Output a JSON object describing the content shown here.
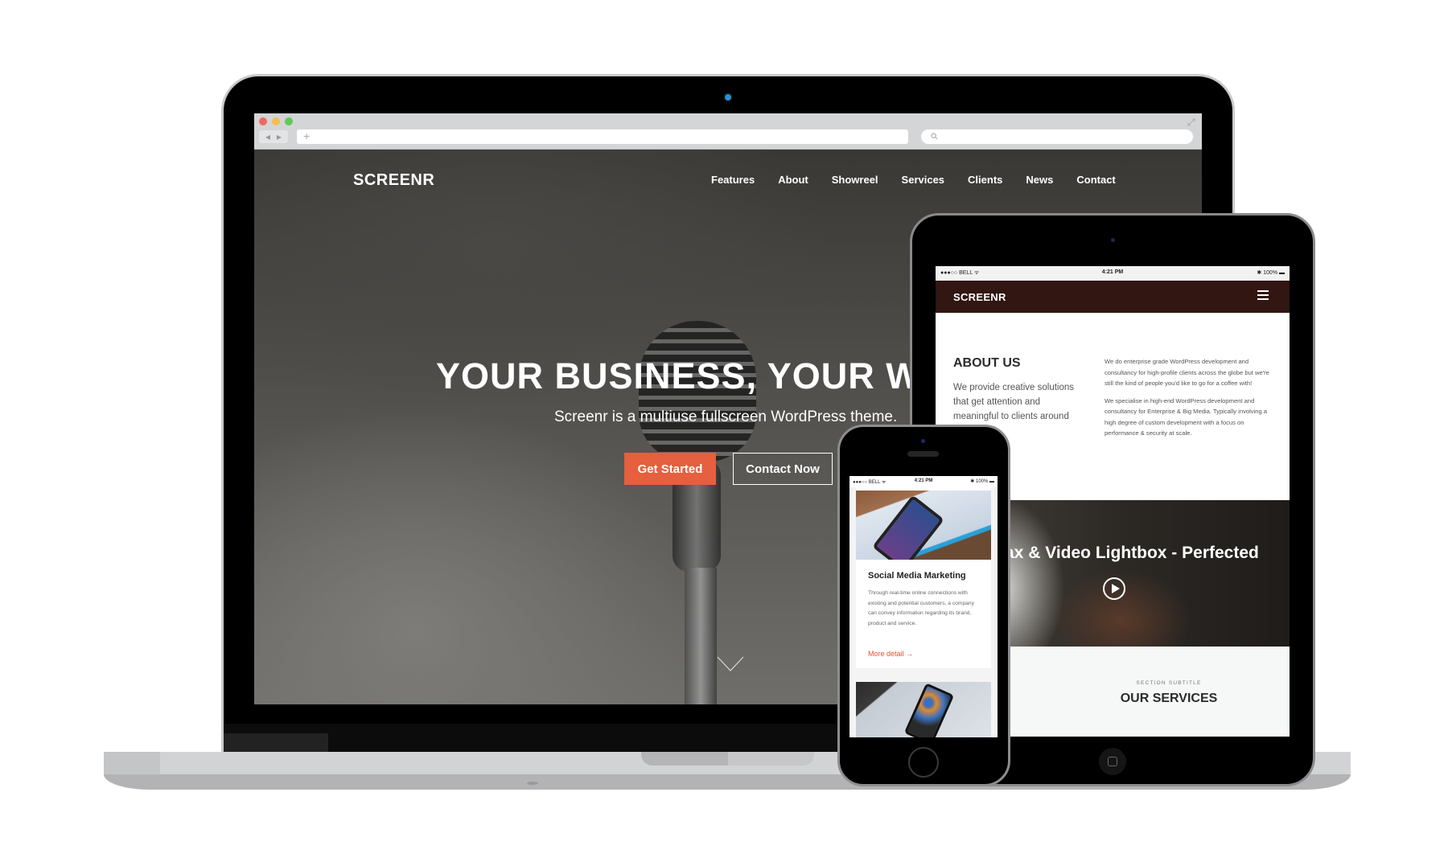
{
  "laptop": {
    "browser": {
      "url_bar_icon": "+",
      "search_icon": "search-icon",
      "back_arrow": "◀",
      "forward_arrow": "▶",
      "expand_icon": "⤢"
    },
    "site": {
      "logo": "SCREENR",
      "nav": [
        "Features",
        "About",
        "Showreel",
        "Services",
        "Clients",
        "News",
        "Contact"
      ],
      "hero_title": "YOUR BUSINESS, YOUR WE",
      "hero_subtitle": "Screenr is a multiuse fullscreen WordPress theme.",
      "primary_button": "Get Started",
      "secondary_button": "Contact Now",
      "accent_color": "#e65f3e"
    }
  },
  "tablet": {
    "status": {
      "carrier": "●●●○○ BELL ᯤ",
      "time": "4:21 PM",
      "battery": "✱ 100% ▬"
    },
    "logo": "SCREENR",
    "header_color": "#311611",
    "about": {
      "title": "ABOUT US",
      "lead": "We provide creative solutions that get attention and meaningful to clients around",
      "paragraphs": [
        "We do enterprise grade WordPress development and consultancy for high-profile clients across the globe but we're still the kind of people you'd like to go for a coffee with!",
        "We specialise in high-end WordPress development and consultancy for Enterprise & Big Media. Typically involving a high degree of custom development with a focus on performance & security at scale."
      ]
    },
    "video": {
      "title": "ax & Video Lightbox - Perfected"
    },
    "services": {
      "subtitle": "SECTION SUBTITLE",
      "title": "OUR SERVICES"
    }
  },
  "phone": {
    "status": {
      "carrier": "●●●○○ BELL ᯤ",
      "time": "4:21 PM",
      "battery": "✱ 100% ▬"
    },
    "card": {
      "title": "Social Media Marketing",
      "text": "Through real-time online connections with existing and potential customers, a company can convey information regarding its brand, product and service.",
      "link": "More detail →",
      "link_color": "#e4502f"
    }
  }
}
